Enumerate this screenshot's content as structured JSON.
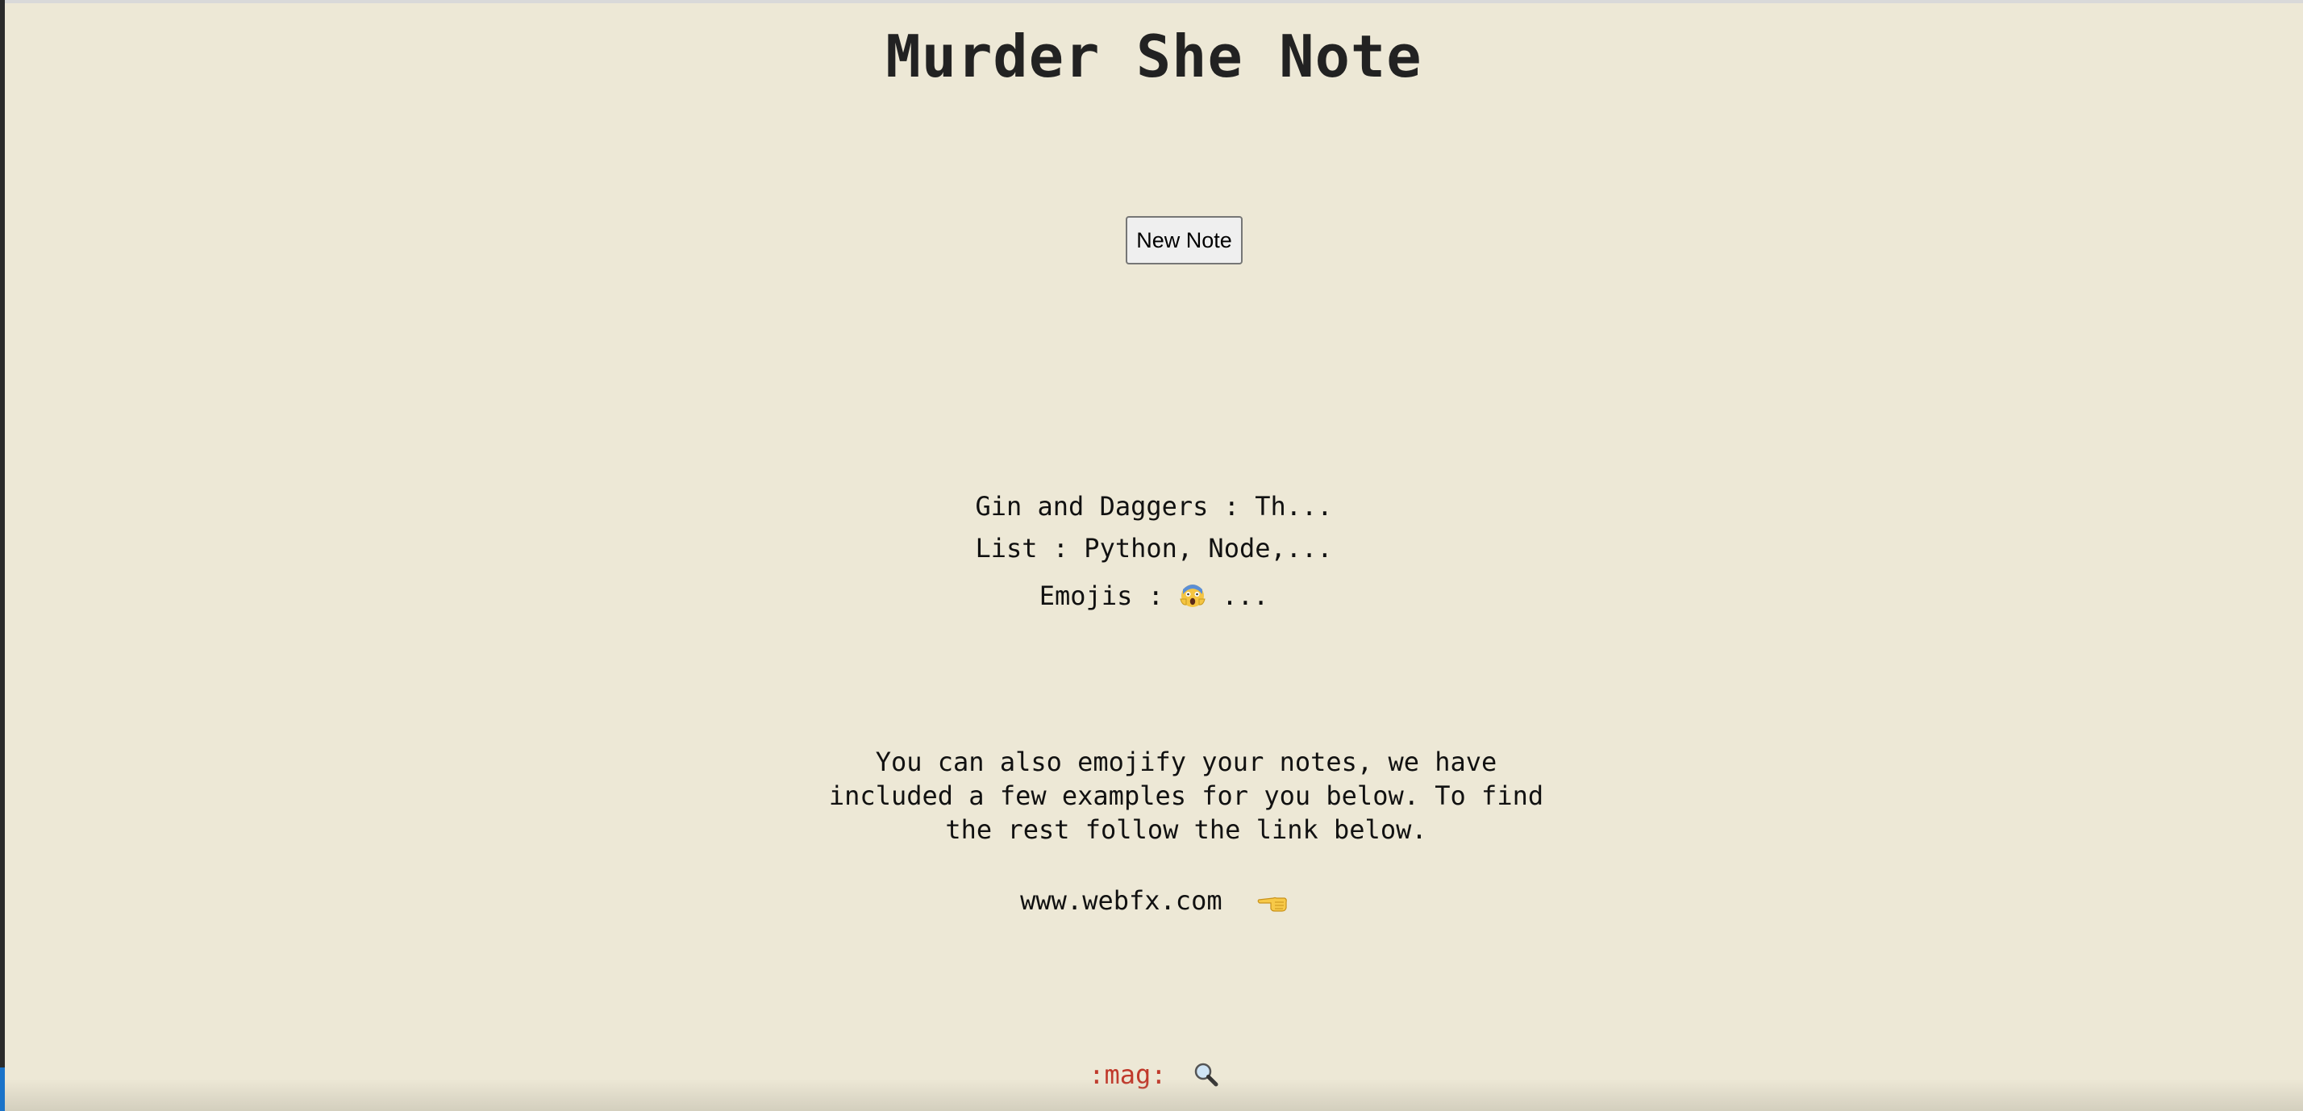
{
  "page": {
    "title": "Murder She Note",
    "background_color": "#ede8d6"
  },
  "toolbar": {
    "new_note_label": "New Note"
  },
  "notes": [
    {
      "text": "Gin and Daggers : Th..."
    },
    {
      "text": "List : Python, Node,..."
    },
    {
      "prefix": "Emojis : ",
      "emoji": "scream-icon",
      "suffix": "..."
    }
  ],
  "info": {
    "text": "You can also emojify your notes, we have included a few examples for you below. To find the rest follow the link below."
  },
  "link": {
    "text": "www.webfx.com",
    "icon": "pointing-left-hand-icon"
  },
  "emoji_examples": [
    {
      "code": ":mag:",
      "icon": "magnifying-glass-icon",
      "code_color": "#c0392b"
    }
  ]
}
